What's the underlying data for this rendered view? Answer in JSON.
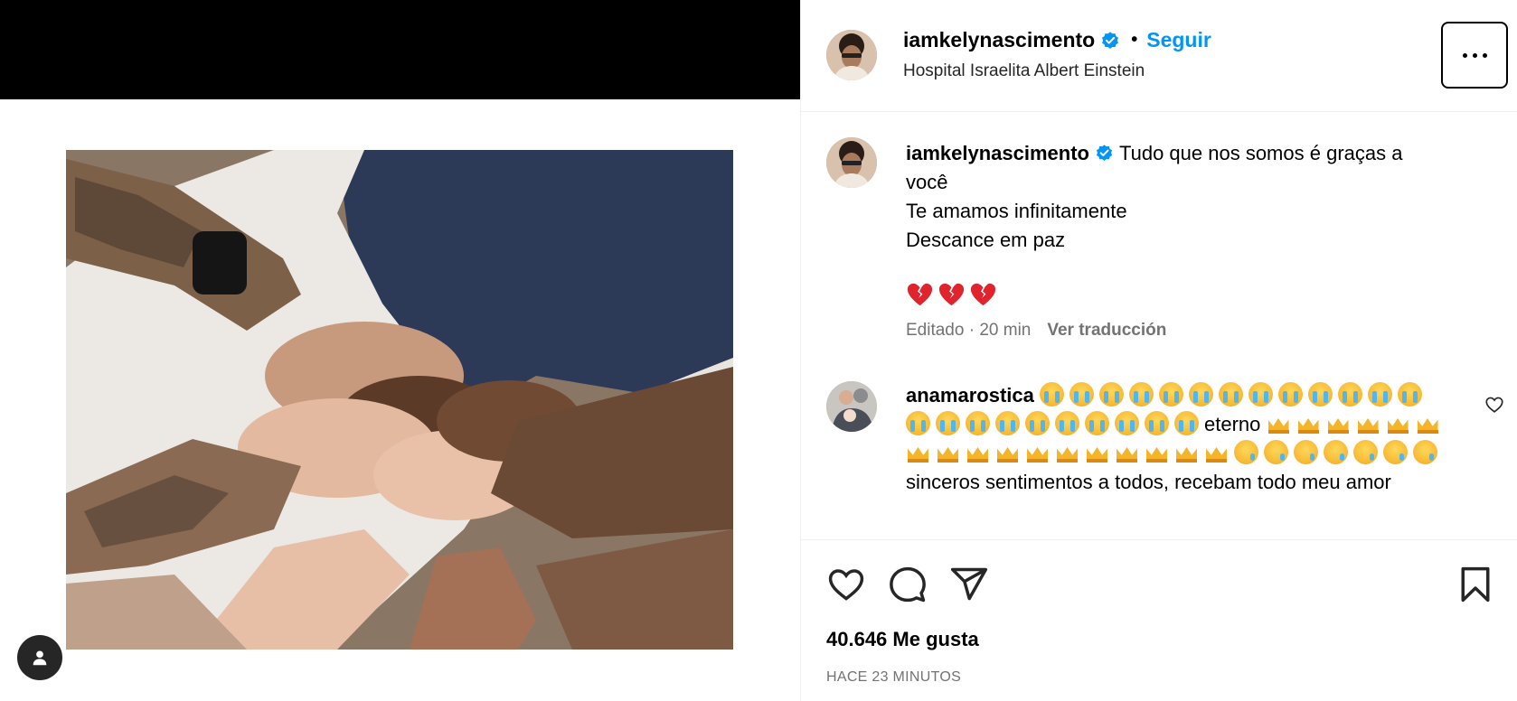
{
  "post": {
    "author": {
      "username": "iamkelynascimento",
      "verified": true,
      "avatar_icon": "profile-photo"
    },
    "header": {
      "separator": "•",
      "follow_label": "Seguir",
      "location": "Hospital Israelita Albert Einstein",
      "more_icon": "more-horizontal-icon"
    },
    "media": {
      "description_icon": "post-photo",
      "user_tag_icon": "user-icon"
    },
    "caption": {
      "lines": [
        "Tudo que nos somos é graças a",
        "você",
        "Te amamos infinitamente",
        "Descance em paz"
      ],
      "emoji": [
        "broken-heart",
        "broken-heart",
        "broken-heart"
      ],
      "edited": "Editado · 20 min",
      "translate_label": "Ver traducción"
    },
    "comments": [
      {
        "username": "anamarostica",
        "segments": {
          "sob_count_1": 13,
          "sob_count_2": 10,
          "word_1": "eterno",
          "crown_count_1": 5,
          "crown_count_2": 12,
          "sad_count": 7,
          "text_end": "sinceros sentimentos a todos, recebam todo",
          "text_end_2": "meu amor"
        }
      }
    ],
    "actions": {
      "like_icon": "heart-icon",
      "comment_icon": "comment-icon",
      "share_icon": "send-icon",
      "save_icon": "bookmark-icon"
    },
    "likes": "40.646 Me gusta",
    "timestamp": "HACE 23 MINUTOS"
  },
  "colors": {
    "link_blue": "#0095f6",
    "muted": "#737373",
    "verified_blue": "#0095f6"
  }
}
